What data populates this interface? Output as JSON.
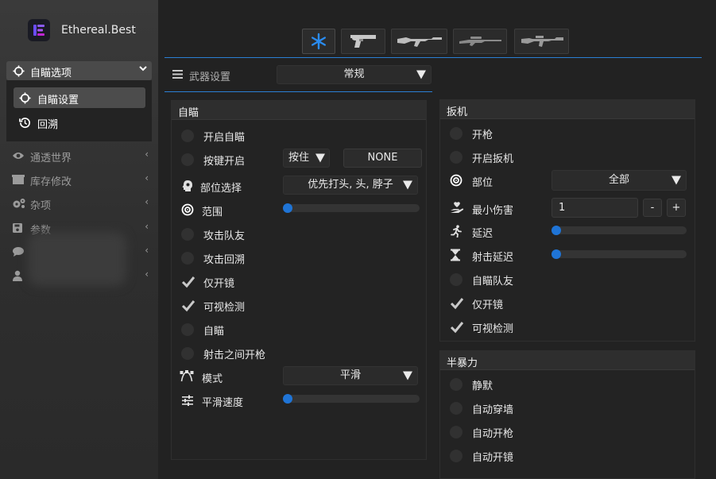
{
  "app": {
    "brand": "Ethereal.Best"
  },
  "sidebar": {
    "aimbot_section": {
      "label": "自瞄选项"
    },
    "sub_items": [
      {
        "label": "自瞄设置",
        "icon": "crosshair-icon",
        "active": true
      },
      {
        "label": "回溯",
        "icon": "history-icon",
        "active": false
      }
    ],
    "items": [
      {
        "label": "通透世界",
        "icon": "eye-icon"
      },
      {
        "label": "库存修改",
        "icon": "box-icon"
      },
      {
        "label": "杂项",
        "icon": "gears-icon"
      },
      {
        "label": "参数",
        "icon": "save-icon"
      },
      {
        "label": "",
        "icon": "chat-icon"
      },
      {
        "label": "",
        "icon": "user-icon"
      }
    ]
  },
  "weapon_tabs": [
    {
      "icon": "asterisk-icon",
      "active": true
    },
    {
      "icon": "pistol-icon",
      "active": false
    },
    {
      "icon": "rifle-icon",
      "active": false
    },
    {
      "icon": "sniper-icon",
      "active": false
    },
    {
      "icon": "smg-icon",
      "active": false
    }
  ],
  "weapon_settings": {
    "label": "武器设置",
    "selected": "常规"
  },
  "aimbot_panel": {
    "title": "自瞄",
    "enable_label": "开启自瞄",
    "key_label": "按键开启",
    "key_mode": "按住",
    "key_value": "NONE",
    "part_label": "部位选择",
    "part_value": "优先打头, 头, 脖子",
    "range_label": "范围",
    "range_value": 0,
    "attack_team_label": "攻击队友",
    "attack_backtrack_label": "攻击回溯",
    "scope_only_label": "仅开镜",
    "visible_check_label": "可视检测",
    "auto_aim_label": "自瞄",
    "fire_between_label": "射击之间开枪",
    "mode_label": "模式",
    "mode_value": "平滑",
    "smooth_speed_label": "平滑速度",
    "smooth_speed_value": 0,
    "checked": {
      "scope_only": true,
      "visible_check": true
    }
  },
  "trigger_panel": {
    "title": "扳机",
    "fire_label": "开枪",
    "enable_trigger_label": "开启扳机",
    "part_label": "部位",
    "part_value": "全部",
    "min_damage_label": "最小伤害",
    "min_damage_value": "1",
    "minus_label": "-",
    "plus_label": "+",
    "delay_label": "延迟",
    "delay_value": 0,
    "shoot_delay_label": "射击延迟",
    "shoot_delay_value": 0,
    "aim_team_label": "自瞄队友",
    "scope_only_label": "仅开镜",
    "visible_check_label": "可视检测",
    "checked": {
      "scope_only": true,
      "visible_check": true
    }
  },
  "semi_rage_panel": {
    "title": "半暴力",
    "silent_label": "静默",
    "autowall_label": "自动穿墙",
    "autofire_label": "自动开枪",
    "autoscope_label": "自动开镜"
  },
  "colors": {
    "accent": "#1f74d6",
    "panel_bg": "#232323",
    "sidebar_bg": "#333333"
  }
}
